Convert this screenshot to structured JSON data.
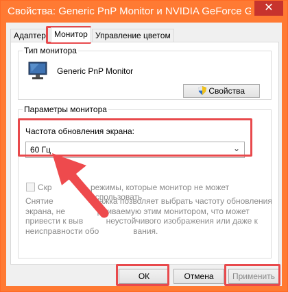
{
  "window": {
    "title": "Свойства: Generic PnP Monitor и NVIDIA GeForce GTS...",
    "close_symbol": "✕"
  },
  "tabs": [
    {
      "label": "Адаптер",
      "active": false
    },
    {
      "label": "Монитор",
      "active": true
    },
    {
      "label": "Управление цветом",
      "active": false
    }
  ],
  "monitor_type": {
    "legend": "Тип монитора",
    "monitor_name": "Generic PnP Monitor",
    "icon": "monitor-icon",
    "properties_button": "Свойства",
    "properties_icon": "uac-shield-icon"
  },
  "monitor_settings": {
    "legend": "Параметры монитора",
    "refresh_label": "Частота обновления экрана:",
    "refresh_value": "60 Гц",
    "hide_modes_checked": false,
    "hide_modes_label_a": "Скр",
    "hide_modes_label_b": "режимы, которые монитор не может использовать",
    "description_lines": [
      "Снятие                  лажка позволяет выбрать частоту обновления",
      "экрана, не              рживаемую этим монитором, что может",
      "привести к выв          неустойчивого изображения или даже к",
      "неисправности обо               вания."
    ]
  },
  "buttons": {
    "ok": "ОК",
    "cancel": "Отмена",
    "apply": "Применить"
  },
  "colors": {
    "title_bar": "#ff7a33",
    "highlight": "#e8494c",
    "arrow": "#ee4a4d"
  }
}
